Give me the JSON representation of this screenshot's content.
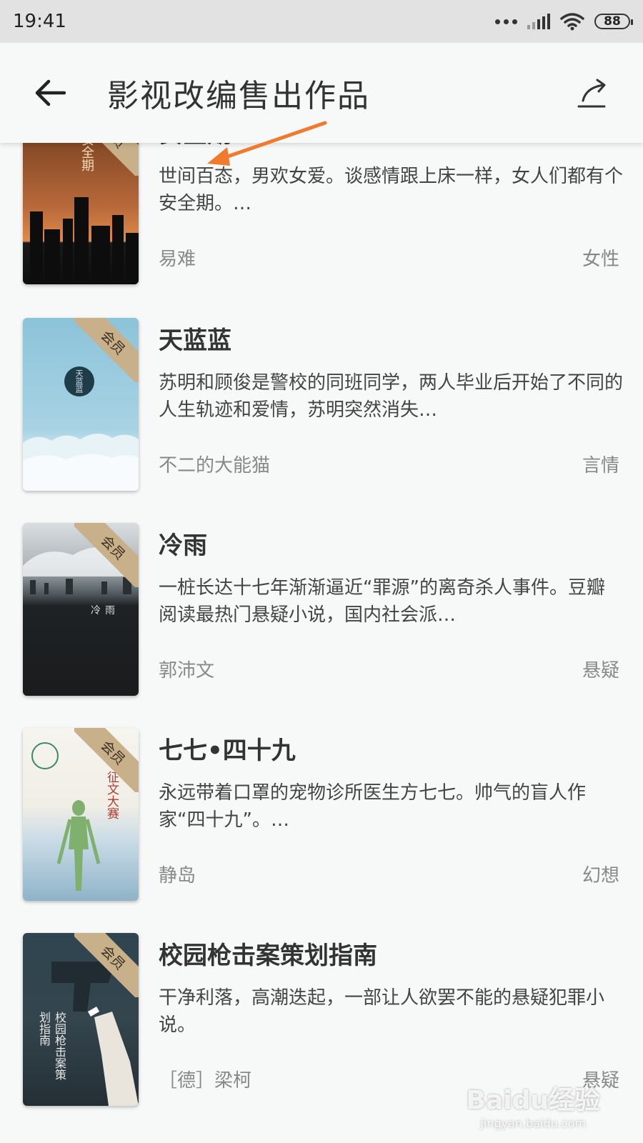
{
  "status": {
    "time": "19:41",
    "battery": "88"
  },
  "header": {
    "title": "影视改编售出作品"
  },
  "books": [
    {
      "title": "安全期",
      "desc": "世间百态，男欢女爱。谈感情跟上床一样，女人们都有个安全期。…",
      "author": "易难",
      "genre": "女性",
      "badge": "会员",
      "cover_text": "安全期"
    },
    {
      "title": "天蓝蓝",
      "desc": "苏明和顾俊是警校的同班同学，两人毕业后开始了不同的人生轨迹和爱情，苏明突然消失…",
      "author": "不二的大能猫",
      "genre": "言情",
      "badge": "会员",
      "cover_text": "天蓝蓝"
    },
    {
      "title": "冷雨",
      "desc": "一桩长达十七年渐渐逼近“罪源”的离奇杀人事件。豆瓣阅读最热门悬疑小说，国内社会派…",
      "author": "郭沛文",
      "genre": "悬疑",
      "badge": "会员",
      "cover_text": "冷雨"
    },
    {
      "title": "七七•四十九",
      "desc": "永远带着口罩的宠物诊所医生方七七。帅气的盲人作家“四十九”。…",
      "author": "静岛",
      "genre": "幻想",
      "badge": "会员",
      "cover_text": "征文大赛"
    },
    {
      "title": "校园枪击案策划指南",
      "desc": "干净利落，高潮迭起，一部让人欲罢不能的悬疑犯罪小说。",
      "author": "［德］梁柯",
      "genre": "悬疑",
      "badge": "会员",
      "cover_text": "校园枪击案策划指南"
    }
  ],
  "watermark": {
    "main": "Baidu经验",
    "sub": "jingyan.baidu.com"
  },
  "colors": {
    "accent_arrow": "#f07a2e",
    "badge": "#c8b08a"
  }
}
